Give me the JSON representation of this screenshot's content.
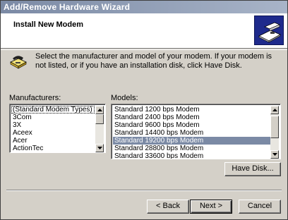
{
  "window": {
    "title": "Add/Remove Hardware Wizard"
  },
  "header": {
    "heading": "Install New Modem",
    "icon": "modem-card-icon"
  },
  "instruction": "Select the manufacturer and model of your modem. If your modem is not listed, or if you have an installation disk, click Have Disk.",
  "manufacturers": {
    "label": "Manufacturers:",
    "items": [
      "(Standard Modem Types)",
      "3Com",
      "3X",
      "Aceex",
      "Acer",
      "ActionTec"
    ],
    "selected_index": 0
  },
  "models": {
    "label": "Models:",
    "items": [
      "Standard  1200 bps Modem",
      "Standard  2400 bps Modem",
      "Standard  9600 bps Modem",
      "Standard 14400 bps Modem",
      "Standard 19200 bps Modem",
      "Standard 28800 bps Modem",
      "Standard 33600 bps Modem"
    ],
    "selected_index": 4
  },
  "buttons": {
    "have_disk": "Have Disk...",
    "back": "< Back",
    "next": "Next >",
    "cancel": "Cancel"
  },
  "colors": {
    "title_bar": "#7b8aa5",
    "selection": "#7b8aa5",
    "header_icon_bg": "#1e2a8c"
  }
}
